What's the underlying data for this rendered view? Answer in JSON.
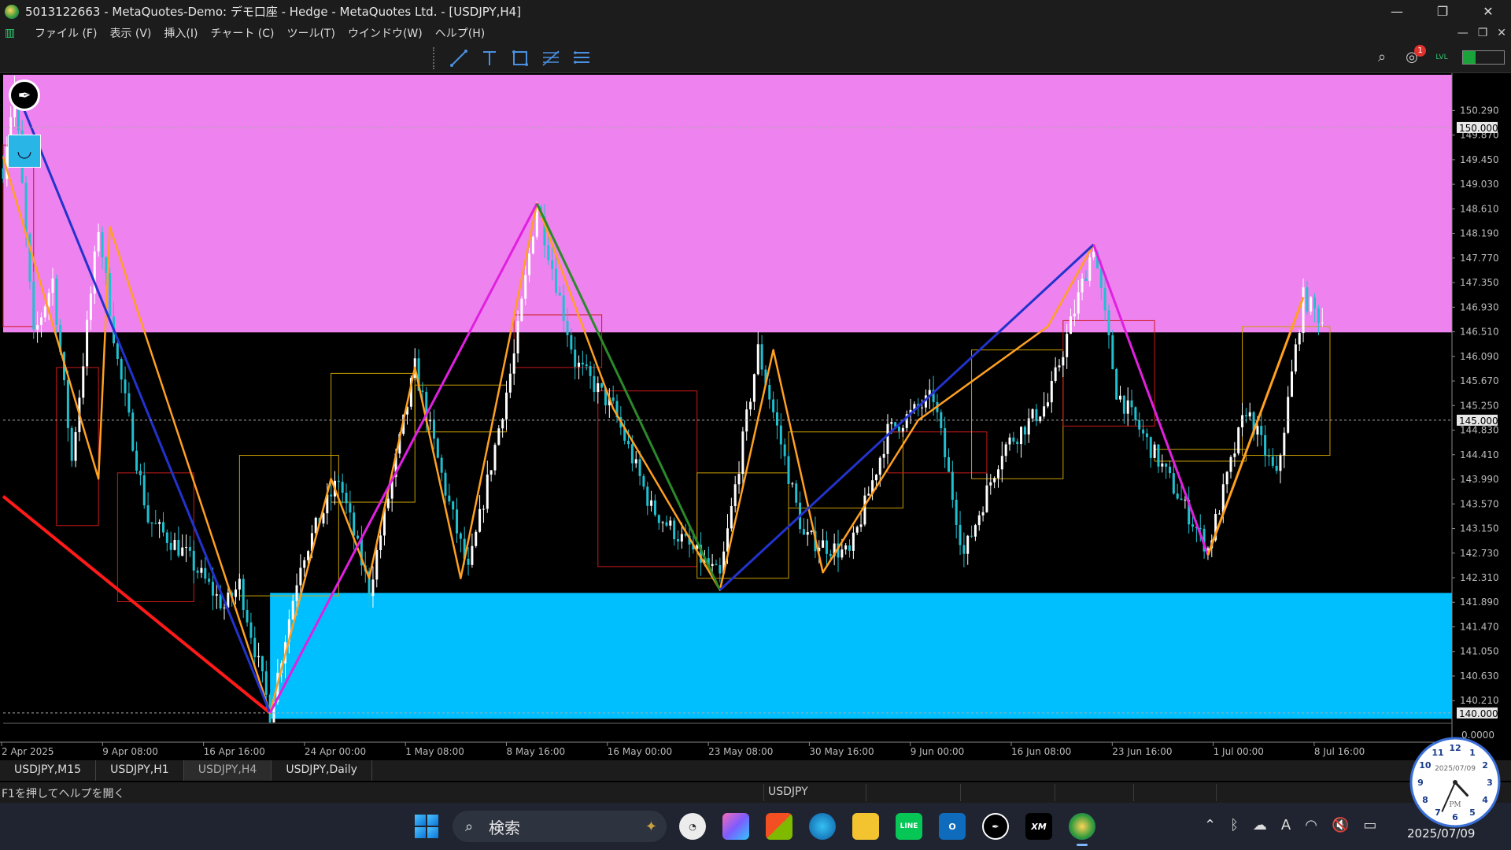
{
  "window": {
    "title": "5013122663 - MetaQuotes-Demo: デモ口座 - Hedge - MetaQuotes Ltd. - [USDJPY,H4]",
    "minimize": "—",
    "restore": "❐",
    "close": "✕"
  },
  "menu": {
    "items": [
      "ファイル (F)",
      "表示 (V)",
      "挿入(I)",
      "チャート (C)",
      "ツール(T)",
      "ウインドウ(W)",
      "ヘルプ(H)"
    ],
    "mdi_minimize": "—",
    "mdi_restore": "❐",
    "mdi_close": "✕"
  },
  "toolbar": {
    "tools": [
      "trendline-tool-icon",
      "text-tool-icon",
      "rectangle-tool-icon",
      "fibonacci-tool-icon",
      "channel-tool-icon"
    ],
    "notifications_count": "1",
    "lvl_label": "LVL",
    "level_fill": 0.3
  },
  "chart_data": {
    "type": "candlestick",
    "symbol": "USDJPY",
    "timeframe": "H4",
    "y_ticks": [
      "150.290",
      "149.870",
      "149.450",
      "149.030",
      "148.610",
      "148.190",
      "147.770",
      "147.350",
      "146.930",
      "146.510",
      "146.090",
      "145.670",
      "145.250",
      "144.830",
      "144.410",
      "143.990",
      "143.570",
      "143.150",
      "142.730",
      "142.310",
      "141.890",
      "141.470",
      "141.050",
      "140.630",
      "140.210"
    ],
    "price_labels": [
      "150.000",
      "145.000",
      "140.000"
    ],
    "indicator_zero": "0.0000",
    "x_ticks": [
      "2 Apr 2025",
      "9 Apr 08:00",
      "16 Apr 16:00",
      "24 Apr 00:00",
      "1 May 08:00",
      "8 May 16:00",
      "16 May 00:00",
      "23 May 08:00",
      "30 May 16:00",
      "9 Jun 00:00",
      "16 Jun 08:00",
      "23 Jun 16:00",
      "1 Jul 00:00",
      "8 Jul 16:00"
    ],
    "zones": {
      "supply": {
        "from": 146.5,
        "to": 150.9,
        "color": "#ee82ee"
      },
      "demand": {
        "from": 139.9,
        "to": 142.05,
        "color": "#00bfff"
      }
    },
    "price_path": [
      {
        "x": 0,
        "y": 149.3
      },
      {
        "x": 3,
        "y": 150.7
      },
      {
        "x": 8,
        "y": 146.4
      },
      {
        "x": 13,
        "y": 147.4
      },
      {
        "x": 18,
        "y": 144.3
      },
      {
        "x": 25,
        "y": 148.3
      },
      {
        "x": 30,
        "y": 146.0
      },
      {
        "x": 38,
        "y": 143.3
      },
      {
        "x": 48,
        "y": 142.7
      },
      {
        "x": 58,
        "y": 141.8
      },
      {
        "x": 62,
        "y": 142.2
      },
      {
        "x": 70,
        "y": 140.0
      },
      {
        "x": 78,
        "y": 142.6
      },
      {
        "x": 88,
        "y": 144.0
      },
      {
        "x": 96,
        "y": 142.1
      },
      {
        "x": 108,
        "y": 145.9
      },
      {
        "x": 116,
        "y": 143.8
      },
      {
        "x": 122,
        "y": 142.4
      },
      {
        "x": 134,
        "y": 146.1
      },
      {
        "x": 140,
        "y": 148.7
      },
      {
        "x": 150,
        "y": 146.0
      },
      {
        "x": 160,
        "y": 145.2
      },
      {
        "x": 170,
        "y": 143.5
      },
      {
        "x": 188,
        "y": 142.3
      },
      {
        "x": 198,
        "y": 146.2
      },
      {
        "x": 210,
        "y": 143.0
      },
      {
        "x": 222,
        "y": 142.7
      },
      {
        "x": 232,
        "y": 144.8
      },
      {
        "x": 244,
        "y": 145.4
      },
      {
        "x": 252,
        "y": 142.7
      },
      {
        "x": 262,
        "y": 144.5
      },
      {
        "x": 274,
        "y": 145.3
      },
      {
        "x": 286,
        "y": 148.0
      },
      {
        "x": 292,
        "y": 145.5
      },
      {
        "x": 304,
        "y": 144.2
      },
      {
        "x": 316,
        "y": 142.8
      },
      {
        "x": 326,
        "y": 145.2
      },
      {
        "x": 334,
        "y": 144.0
      },
      {
        "x": 341,
        "y": 147.1
      },
      {
        "x": 346,
        "y": 146.7
      }
    ],
    "zigzag_major": [
      {
        "x": 3,
        "y": 150.7,
        "color": "#2233cc"
      },
      {
        "x": 70,
        "y": 140.0
      },
      {
        "x": 140,
        "y": 148.7
      },
      {
        "x": 188,
        "y": 142.1
      },
      {
        "x": 286,
        "y": 148.0
      },
      {
        "x": 316,
        "y": 142.7
      },
      {
        "x": 341,
        "y": 147.1
      }
    ],
    "zigzag_minor": [
      {
        "x": 0,
        "y": 149.5
      },
      {
        "x": 25,
        "y": 144.0
      },
      {
        "x": 28,
        "y": 148.3
      },
      {
        "x": 70,
        "y": 140.0
      },
      {
        "x": 86,
        "y": 144.0
      },
      {
        "x": 96,
        "y": 142.3
      },
      {
        "x": 108,
        "y": 145.9
      },
      {
        "x": 120,
        "y": 142.3
      },
      {
        "x": 140,
        "y": 148.7
      },
      {
        "x": 160,
        "y": 145.2
      },
      {
        "x": 188,
        "y": 142.1
      },
      {
        "x": 202,
        "y": 146.2
      },
      {
        "x": 215,
        "y": 142.4
      },
      {
        "x": 240,
        "y": 145.0
      },
      {
        "x": 274,
        "y": 146.6
      },
      {
        "x": 286,
        "y": 148.0
      },
      {
        "x": 316,
        "y": 142.7
      },
      {
        "x": 341,
        "y": 147.1
      }
    ],
    "red_line": [
      {
        "x": 0,
        "y": 143.7
      },
      {
        "x": 70,
        "y": 140.0
      }
    ]
  },
  "tabs": [
    "USDJPY,M15",
    "USDJPY,H1",
    "USDJPY,H4",
    "USDJPY,Daily"
  ],
  "active_tab": "USDJPY,H4",
  "status": {
    "help": "F1を押してヘルプを開く",
    "symbol": "USDJPY"
  },
  "taskbar": {
    "search_placeholder": "検索",
    "apps": [
      "clock-app",
      "copilot-app",
      "store-app",
      "edge-app",
      "explorer-app",
      "line-app",
      "outlook-app",
      "pen-app",
      "xm-app",
      "metatrader-app"
    ],
    "xm_label": "XM",
    "line_label": "LINE",
    "date": "2025/07/09"
  },
  "clock_widget": {
    "date": "2025/07/09",
    "ampm": "PM",
    "hour": 4,
    "minute": 34
  }
}
